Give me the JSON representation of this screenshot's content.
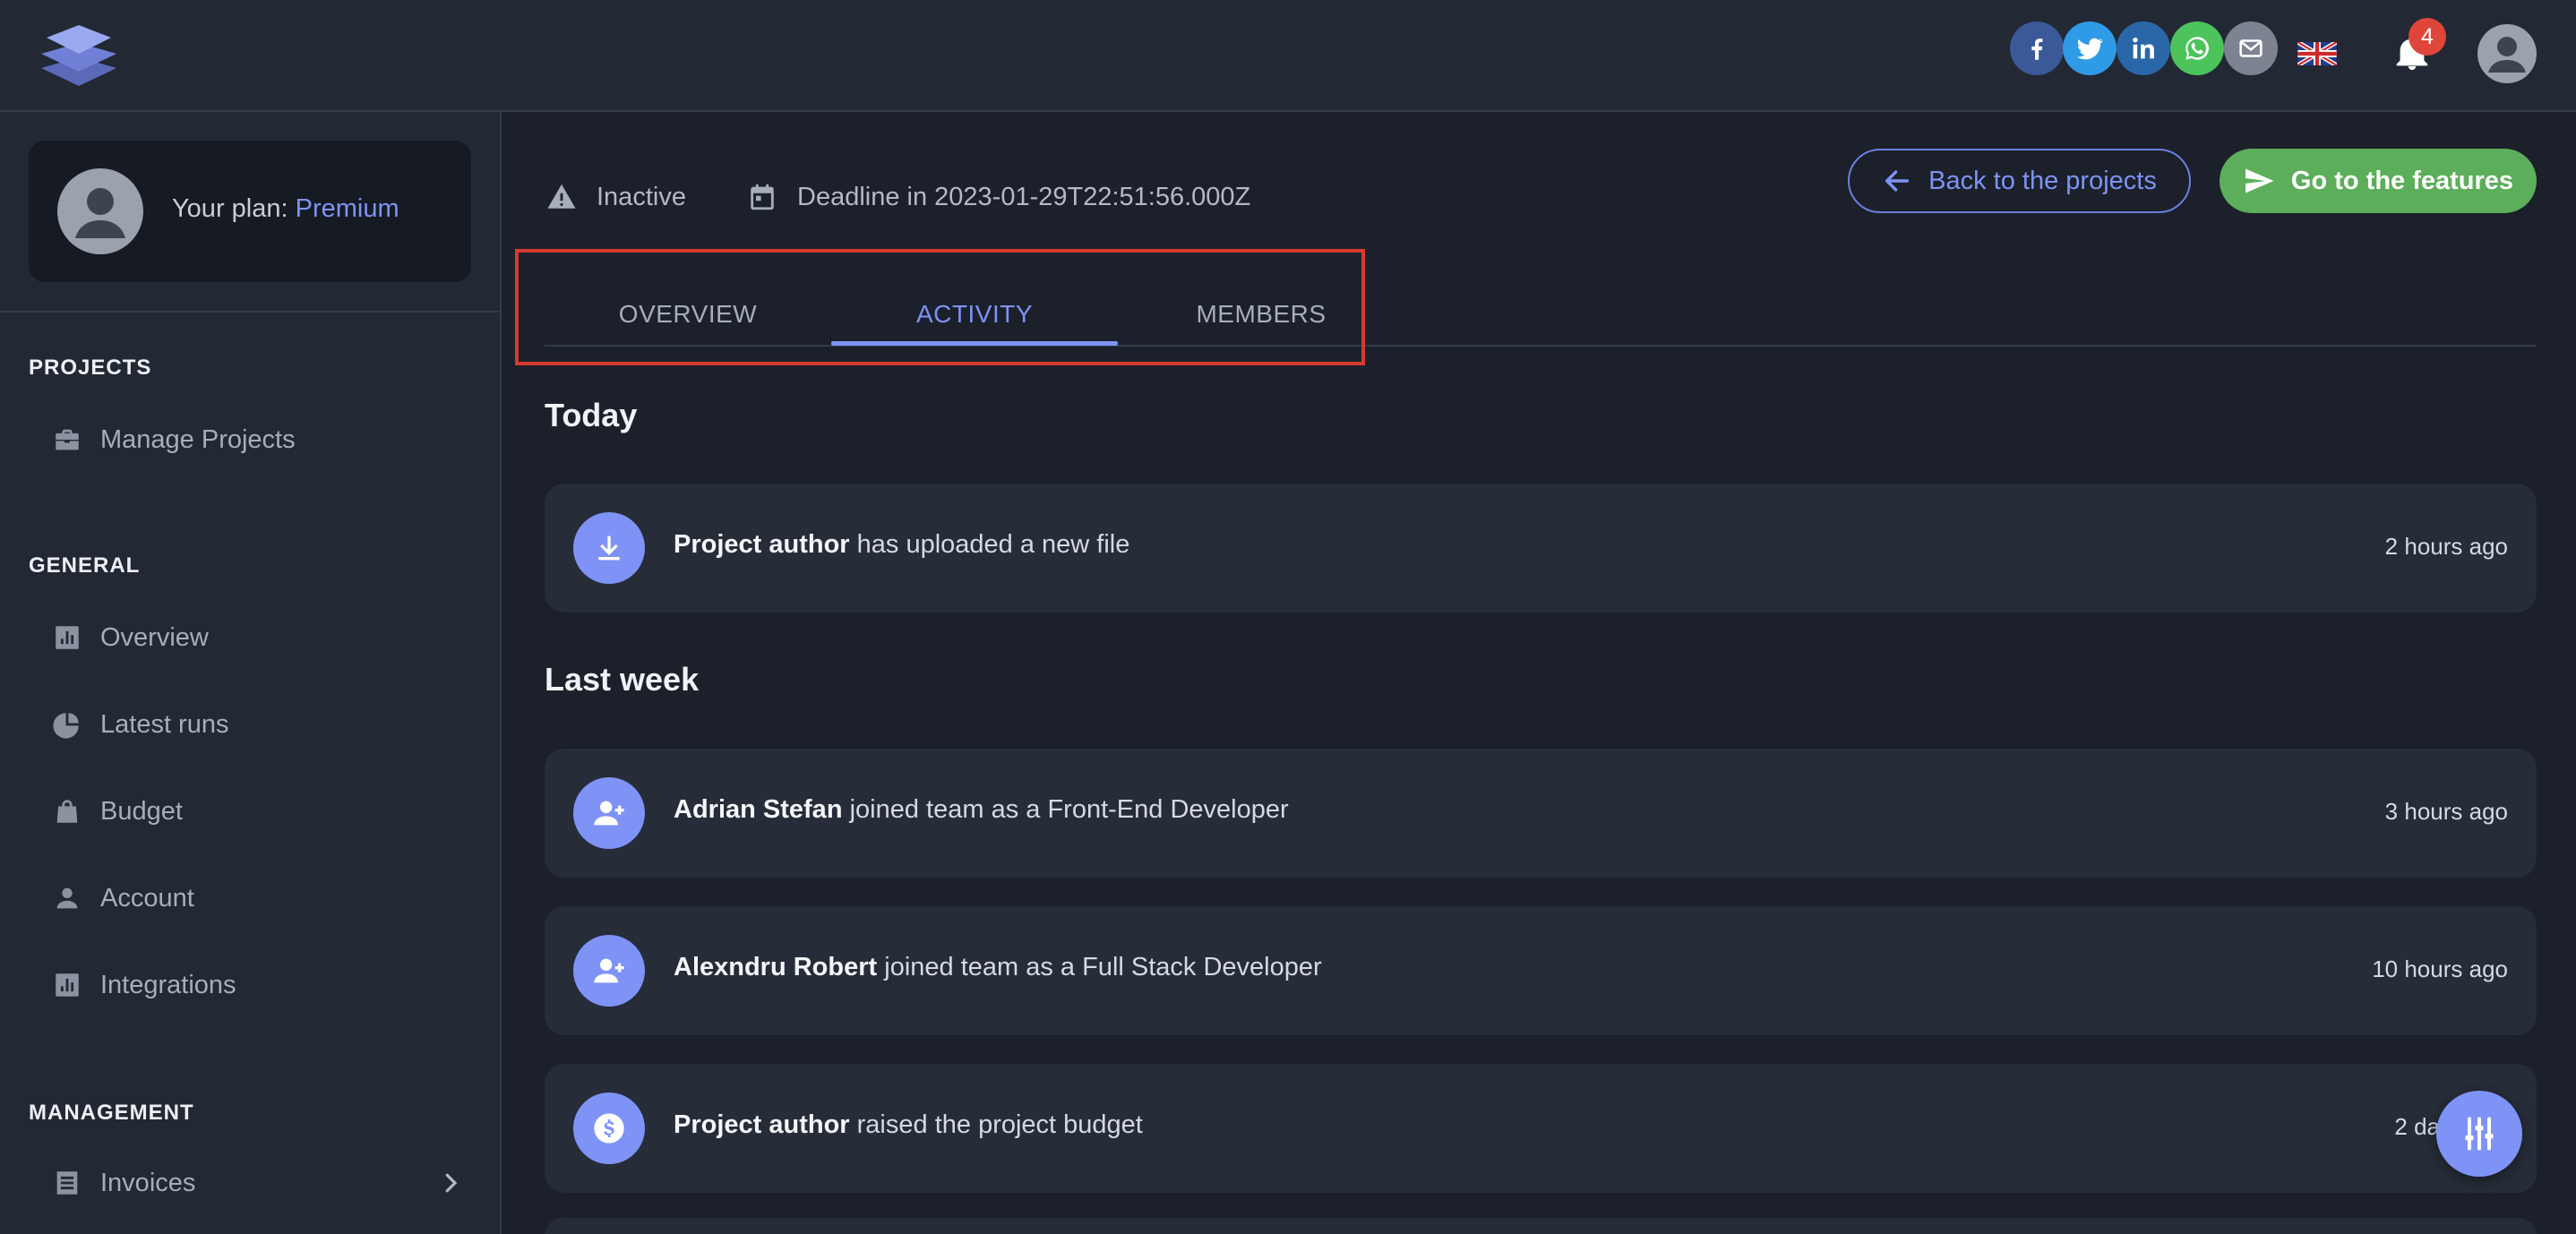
{
  "colors": {
    "accent": "#7e93f5",
    "success": "#5cae5a",
    "danger": "#e0453a",
    "background": "#1b202a",
    "surface": "#222834",
    "card": "#262c38"
  },
  "topbar": {
    "share_icons": [
      "facebook-icon",
      "twitter-icon",
      "linkedin-icon",
      "whatsapp-icon",
      "email-icon"
    ],
    "language_icon": "uk-flag-icon",
    "notifications_count": "4"
  },
  "sidebar": {
    "plan_label": "Your plan: ",
    "plan_value": "Premium",
    "sections": [
      {
        "title": "PROJECTS",
        "items": [
          {
            "label": "Manage Projects",
            "icon": "briefcase-icon"
          }
        ]
      },
      {
        "title": "GENERAL",
        "items": [
          {
            "label": "Overview",
            "icon": "bar-chart-icon"
          },
          {
            "label": "Latest runs",
            "icon": "pie-chart-icon"
          },
          {
            "label": "Budget",
            "icon": "bag-icon"
          },
          {
            "label": "Account",
            "icon": "person-icon"
          },
          {
            "label": "Integrations",
            "icon": "bar-chart-icon"
          }
        ]
      },
      {
        "title": "MANAGEMENT",
        "items": [
          {
            "label": "Invoices",
            "icon": "invoice-icon"
          }
        ]
      }
    ]
  },
  "project": {
    "status": "Inactive",
    "deadline": "Deadline in 2023-01-29T22:51:56.000Z",
    "back_button": "Back to the projects",
    "features_button": "Go to the features"
  },
  "tabs": [
    {
      "label": "OVERVIEW",
      "active": false
    },
    {
      "label": "ACTIVITY",
      "active": true
    },
    {
      "label": "MEMBERS",
      "active": false
    }
  ],
  "activity": {
    "groups": [
      {
        "title": "Today",
        "items": [
          {
            "who": "Project author",
            "text": " has uploaded a new file",
            "time": "2 hours ago",
            "icon": "download-icon"
          }
        ]
      },
      {
        "title": "Last week",
        "items": [
          {
            "who": "Adrian Stefan",
            "text": " joined team as a Front-End Developer",
            "time": "3 hours ago",
            "icon": "person-add-icon"
          },
          {
            "who": "Alexndru Robert",
            "text": " joined team as a Full Stack Developer",
            "time": "10 hours ago",
            "icon": "person-add-icon"
          },
          {
            "who": "Project author",
            "text": " raised the project budget",
            "time": "2 da",
            "icon": "dollar-icon"
          }
        ]
      }
    ]
  }
}
